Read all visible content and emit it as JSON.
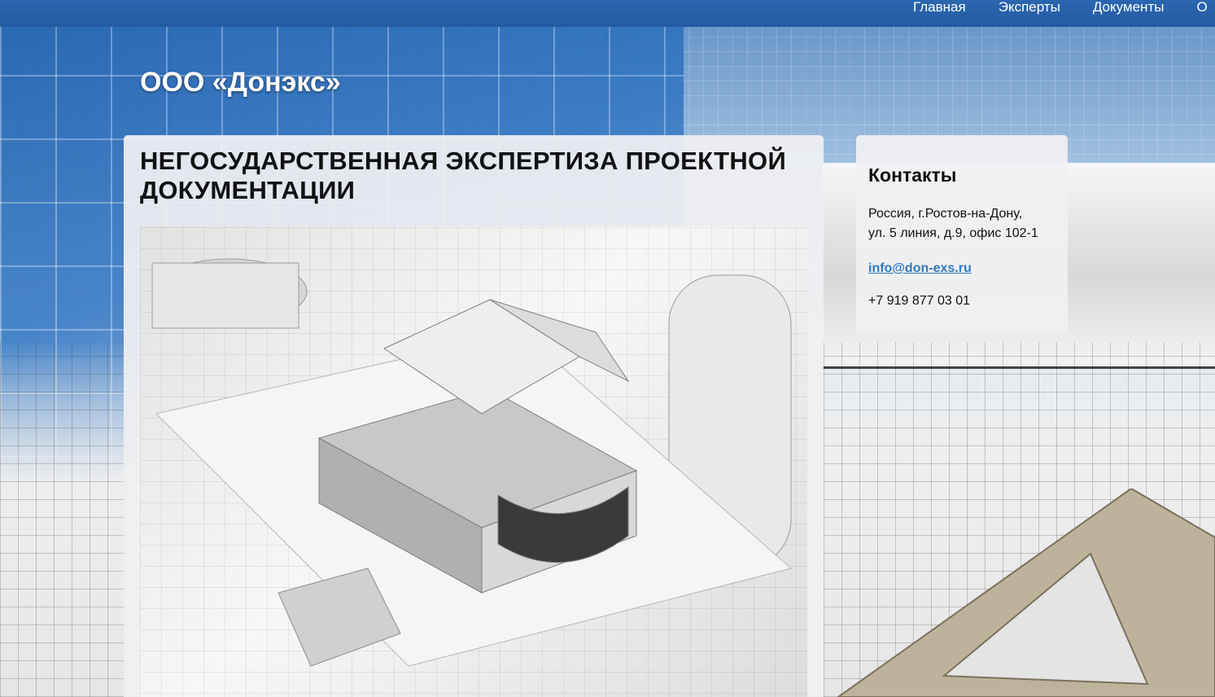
{
  "nav": {
    "items": [
      {
        "label": "Главная"
      },
      {
        "label": "Эксперты"
      },
      {
        "label": "Документы"
      },
      {
        "label": "О"
      }
    ]
  },
  "site": {
    "title": "ООО «Донэкс»"
  },
  "main": {
    "heading": "НЕГОСУДАРСТВЕННАЯ ЭКСПЕРТИЗА ПРОЕКТНОЙ ДОКУМЕНТАЦИИ",
    "image": "house-model-on-blueprints"
  },
  "contacts": {
    "heading": "Контакты",
    "address_line1": "Россия, г.Ростов-на-Дону,",
    "address_line2": "ул. 5 линия, д.9, офис 102-1",
    "email": "info@don-exs.ru",
    "phone": "+7 919 877 03 01"
  },
  "colors": {
    "topbar": "#2b66b0",
    "link": "#2f7bc4",
    "panel": "#f0f0f2"
  }
}
